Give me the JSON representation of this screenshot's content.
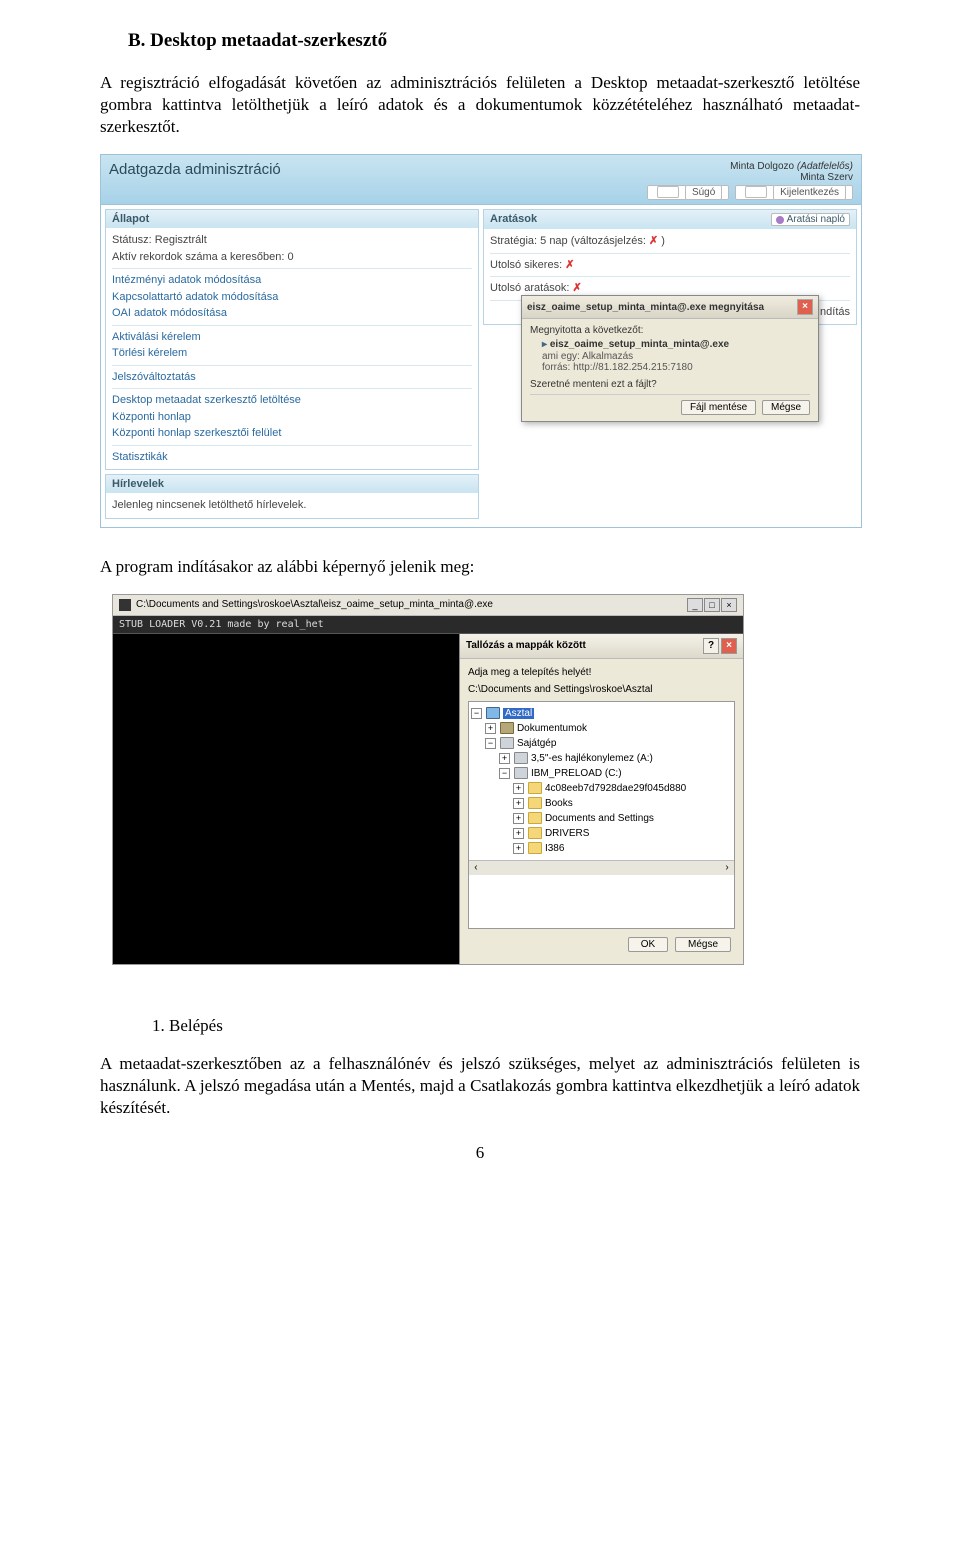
{
  "doc": {
    "heading": "B. Desktop metaadat-szerkesztő",
    "para1": "A regisztráció elfogadását követően az adminisztrációs felületen a Desktop metaadat-szerkesztő letöltése gombra kattintva letölthetjük a leíró adatok és a dokumentumok közzétételéhez használható metaadat-szerkesztőt.",
    "para2": "A program indításakor az alábbi képernyő jelenik meg:",
    "step1": "1.  Belépés",
    "para3": "A metaadat-szerkesztőben az a felhasználónév és jelszó szükséges, melyet az adminisztrációs felületen is használunk. A jelszó megadása után a Mentés, majd a Csatlakozás gombra kattintva elkezdhetjük a leíró adatok készítését.",
    "pagenum": "6"
  },
  "admin": {
    "title": "Adatgazda adminisztráció",
    "user_name": "Minta Dolgozo",
    "user_role": "(Adatfelelős)",
    "user_org": "Minta Szerv",
    "help": "Súgó",
    "logout": "Kijelentkezés",
    "allapot": {
      "head": "Állapot",
      "status": "Státusz: Regisztrált",
      "active": "Aktív rekordok száma a keresőben: 0",
      "links": [
        "Intézményi adatok módosítása",
        "Kapcsolattartó adatok módosítása",
        "OAI adatok módosítása",
        "Aktiválási kérelem",
        "Törlési kérelem",
        "Jelszóváltoztatás",
        "Desktop metaadat szerkesztő letöltése",
        "Központi honlap",
        "Központi honlap szerkesztői felület",
        "Statisztikák"
      ]
    },
    "aratasok": {
      "head": "Aratások",
      "log_btn": "Aratási napló",
      "strategy": "Stratégia: 5 nap (változásjelzés: ",
      "last_ok": "Utolsó sikeres: ",
      "last": "Utolsó aratások: ",
      "behind_log": "ratási napló",
      "behind_start": "Indítás"
    },
    "hirlevelek": {
      "head": "Hírlevelek",
      "body": "Jelenleg nincsenek letölthető hírlevelek."
    }
  },
  "popup": {
    "title": "eisz_oaime_setup_minta_minta@.exe megnyitása",
    "opened": "Megnyitotta a következőt:",
    "file": "eisz_oaime_setup_minta_minta@.exe",
    "type": "ami egy: Alkalmazás",
    "source": "forrás: http://81.182.254.215:7180",
    "question": "Szeretné menteni ezt a fájlt?",
    "save": "Fájl mentése",
    "cancel": "Mégse"
  },
  "cmd": {
    "title": "C:\\Documents and Settings\\roskoe\\Asztal\\eisz_oaime_setup_minta_minta@.exe",
    "stub": "STUB LOADER V0.21 made by real_het"
  },
  "browse": {
    "title": "Tallózás a mappák között",
    "hint": "Adja meg a telepítés helyét!",
    "path": "C:\\Documents and Settings\\roskoe\\Asztal",
    "tree": {
      "asztal": "Asztal",
      "dokumentumok": "Dokumentumok",
      "sajatgep": "Sajátgép",
      "floppy": "3,5\"-es hajlékonylemez (A:)",
      "preload": "IBM_PRELOAD (C:)",
      "f1": "4c08eeb7d7928dae29f045d880",
      "f2": "Books",
      "f3": "Documents and Settings",
      "f4": "DRIVERS",
      "f5": "I386"
    },
    "ok": "OK",
    "cancel": "Mégse"
  }
}
